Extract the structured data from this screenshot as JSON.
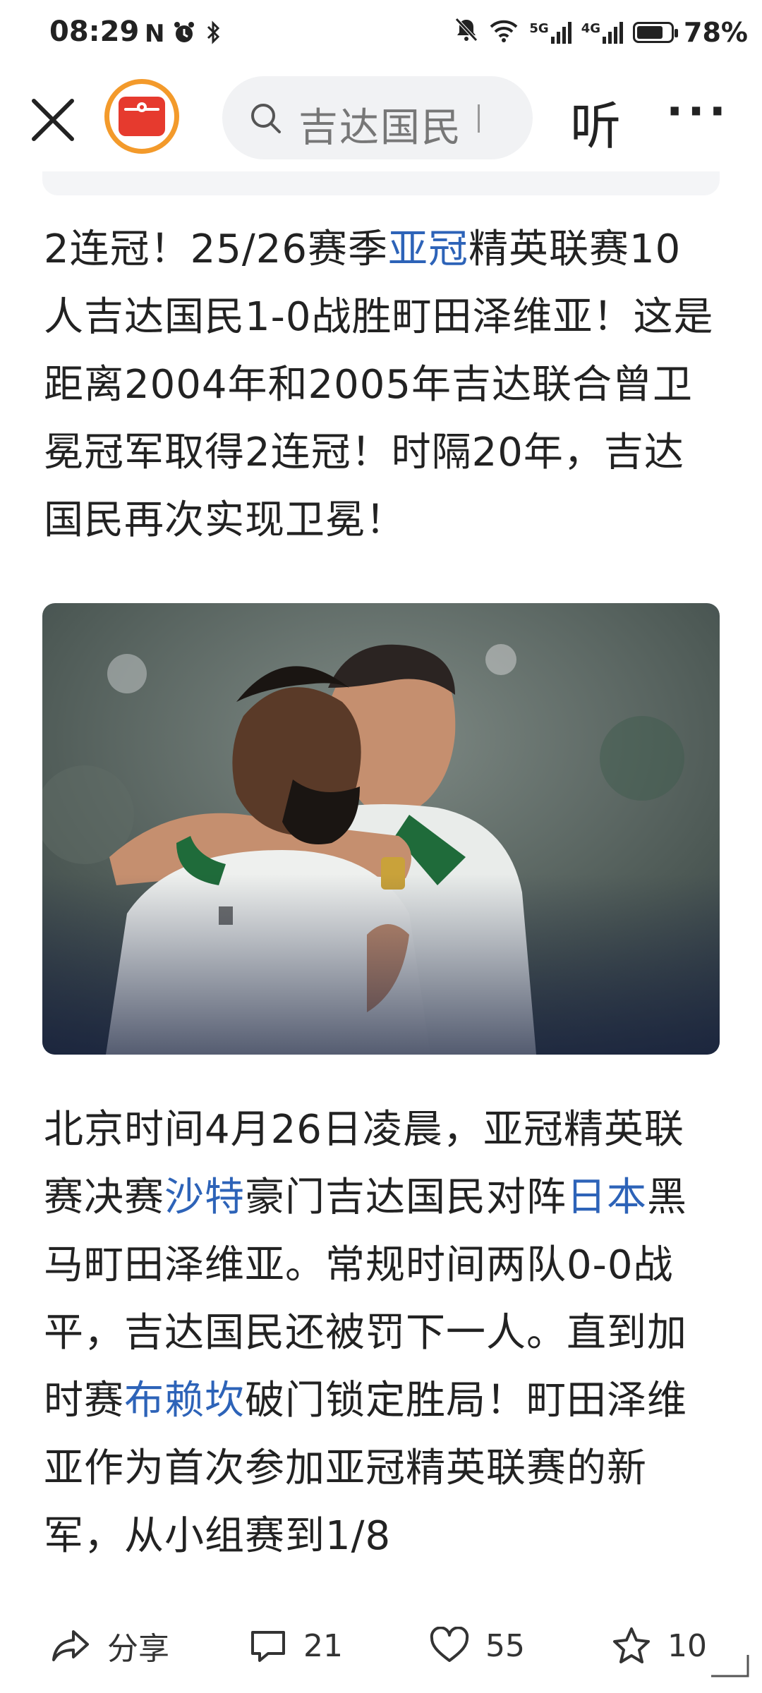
{
  "status_bar": {
    "time": "08:29",
    "left_icons": [
      "N",
      "alarm-icon",
      "bluetooth-icon"
    ],
    "right_icons": [
      "bell-muted-icon",
      "wifi-icon",
      "5G",
      "4G",
      "battery-charging-icon"
    ],
    "signal_5g": "5G",
    "signal_4g": "4G",
    "battery_percent": "78%",
    "battery_level": 0.78
  },
  "nav": {
    "search_query": "吉达国民",
    "listen_label": "听",
    "more_label": "···"
  },
  "article": {
    "para1": [
      {
        "text": "2连冠！25/26赛季",
        "link": false
      },
      {
        "text": "亚冠",
        "link": true
      },
      {
        "text": "精英联赛10人吉达国民1-0战胜町田泽维亚！这是距离2004年和2005年吉达联合曾卫冕冠军取得2连冠！时隔20年，吉达国民再次实现卫冕！",
        "link": false
      }
    ],
    "para2": [
      {
        "text": "北京时间4月26日凌晨，亚冠精英联赛决赛",
        "link": false
      },
      {
        "text": "沙特",
        "link": true
      },
      {
        "text": "豪门吉达国民对阵",
        "link": false
      },
      {
        "text": "日本",
        "link": true
      },
      {
        "text": "黑马町田泽维亚。常规时间两队0-0战平，吉达国民还被罚下一人。直到加时赛",
        "link": false
      },
      {
        "text": "布赖坎",
        "link": true
      },
      {
        "text": "破门锁定胜局！町田泽维亚作为首次参加亚冠精英联赛的新军，从小组赛到1/8",
        "link": false
      }
    ],
    "link_color": "#2d63b8"
  },
  "actions": {
    "share_label": "分享",
    "comment_count": "21",
    "like_count": "55",
    "fav_count": "10"
  },
  "colors": {
    "accent_orange": "#f39a2b",
    "logo_red": "#e63a2e",
    "jersey_green": "#1f6b3a"
  }
}
